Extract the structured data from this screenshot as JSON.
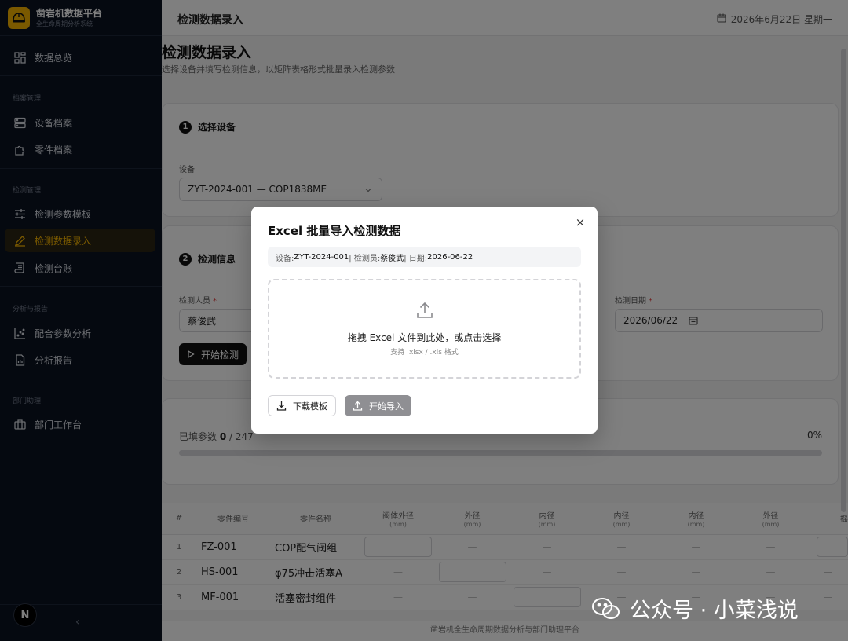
{
  "brand": {
    "title": "凿岩机数据平台",
    "subtitle": "全生命周期分析系统"
  },
  "sidebar": {
    "overview": "数据总览",
    "groups": {
      "archive": "档案管理",
      "inspect": "检测管理",
      "analysis": "分析与报告",
      "dept": "部门助理"
    },
    "items": {
      "device_archive": "设备档案",
      "part_archive": "零件档案",
      "param_template": "检测参数模板",
      "data_entry": "检测数据录入",
      "ledger": "检测台账",
      "fit_analysis": "配合参数分析",
      "report": "分析报告",
      "dept_workbench": "部门工作台"
    },
    "avatar": "N"
  },
  "topbar": {
    "title": "检测数据录入",
    "date": "2026年6月22日 星期一"
  },
  "page": {
    "title": "检测数据录入",
    "subtitle": "选择设备并填写检测信息，以矩阵表格形式批量录入检测参数"
  },
  "step1": {
    "num": "1",
    "label": "选择设备",
    "device_label": "设备",
    "device_value": "ZYT-2024-001 — COP1838ME"
  },
  "step2": {
    "num": "2",
    "label": "检测信息",
    "inspector_label": "检测人员",
    "inspector_value": "蔡俊武",
    "date_label": "检测日期",
    "date_value": "2026/06/22",
    "start_button": "开始检测"
  },
  "progress": {
    "filled_label": "已填参数",
    "filled": "0",
    "total": "/ 247",
    "percent": "0%",
    "fraction": 0
  },
  "table": {
    "headers": [
      "#",
      "零件编号",
      "零件名称",
      "阀体外径",
      "外径",
      "内径",
      "内径",
      "内径",
      "外径",
      "摇"
    ],
    "unit": "(mm)",
    "rows": [
      {
        "idx": "1",
        "code": "FZ-001",
        "name": "COP配气阀组"
      },
      {
        "idx": "2",
        "code": "HS-001",
        "name": "φ75冲击活塞A"
      },
      {
        "idx": "3",
        "code": "MF-001",
        "name": "活塞密封组件"
      }
    ],
    "dash": "—"
  },
  "footer": "凿岩机全生命周期数据分析与部门助理平台",
  "dialog": {
    "title": "Excel 批量导入检测数据",
    "info_device_label": "设备: ",
    "info_device": "ZYT-2024-001",
    "info_inspector_label": " | 检测员: ",
    "info_inspector": "蔡俊武",
    "info_date_label": " | 日期: ",
    "info_date": "2026-06-22",
    "drop_main": "拖拽 Excel 文件到此处，或点击选择",
    "drop_sub": "支持 .xlsx / .xls 格式",
    "download_button": "下载模板",
    "import_button": "开始导入",
    "close_symbol": "×"
  },
  "watermark": "公众号 · 小菜浅说"
}
